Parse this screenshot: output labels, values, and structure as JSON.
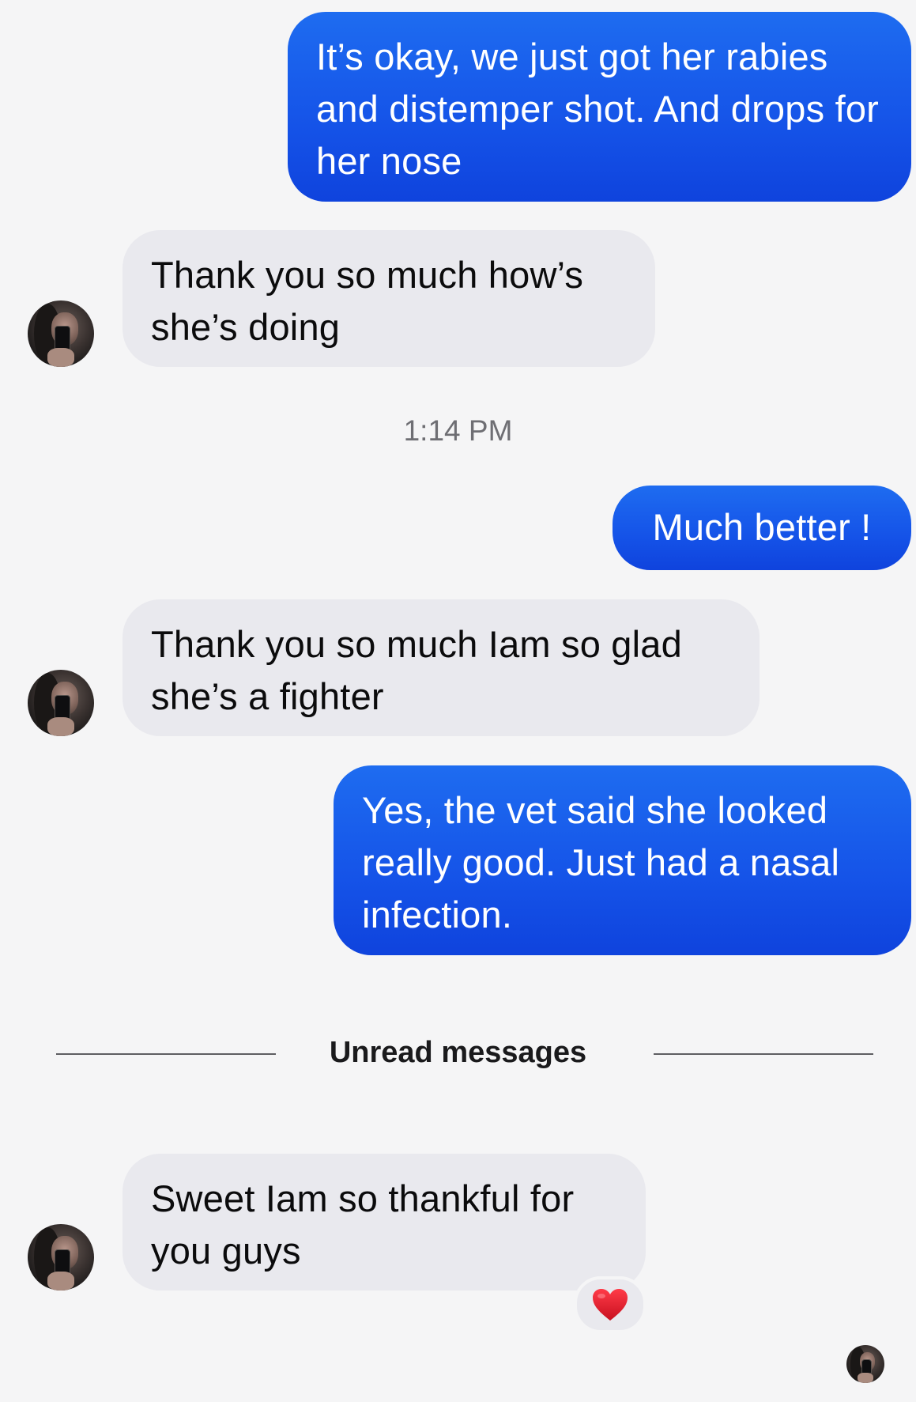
{
  "messages": {
    "m1": {
      "text": "It’s okay, we just got her rabies and distemper shot. And drops for her nose"
    },
    "m2": {
      "text": "Thank you so much how’s she’s doing"
    },
    "timestamp": "1:14 PM",
    "m3": {
      "text": "Much better !"
    },
    "m4": {
      "text": "Thank you so much Iam so glad she’s a fighter"
    },
    "m5": {
      "text": "Yes, the vet said she looked really good. Just had a nasal infection."
    },
    "divider": "Unread messages",
    "m6": {
      "text": "Sweet Iam so thankful for you guys"
    },
    "m6_reaction": "heart-icon"
  },
  "colors": {
    "outgoing": "#1b62ee",
    "incoming": "#e9e9ee",
    "background": "#f5f5f6",
    "reaction": "#e02333"
  }
}
